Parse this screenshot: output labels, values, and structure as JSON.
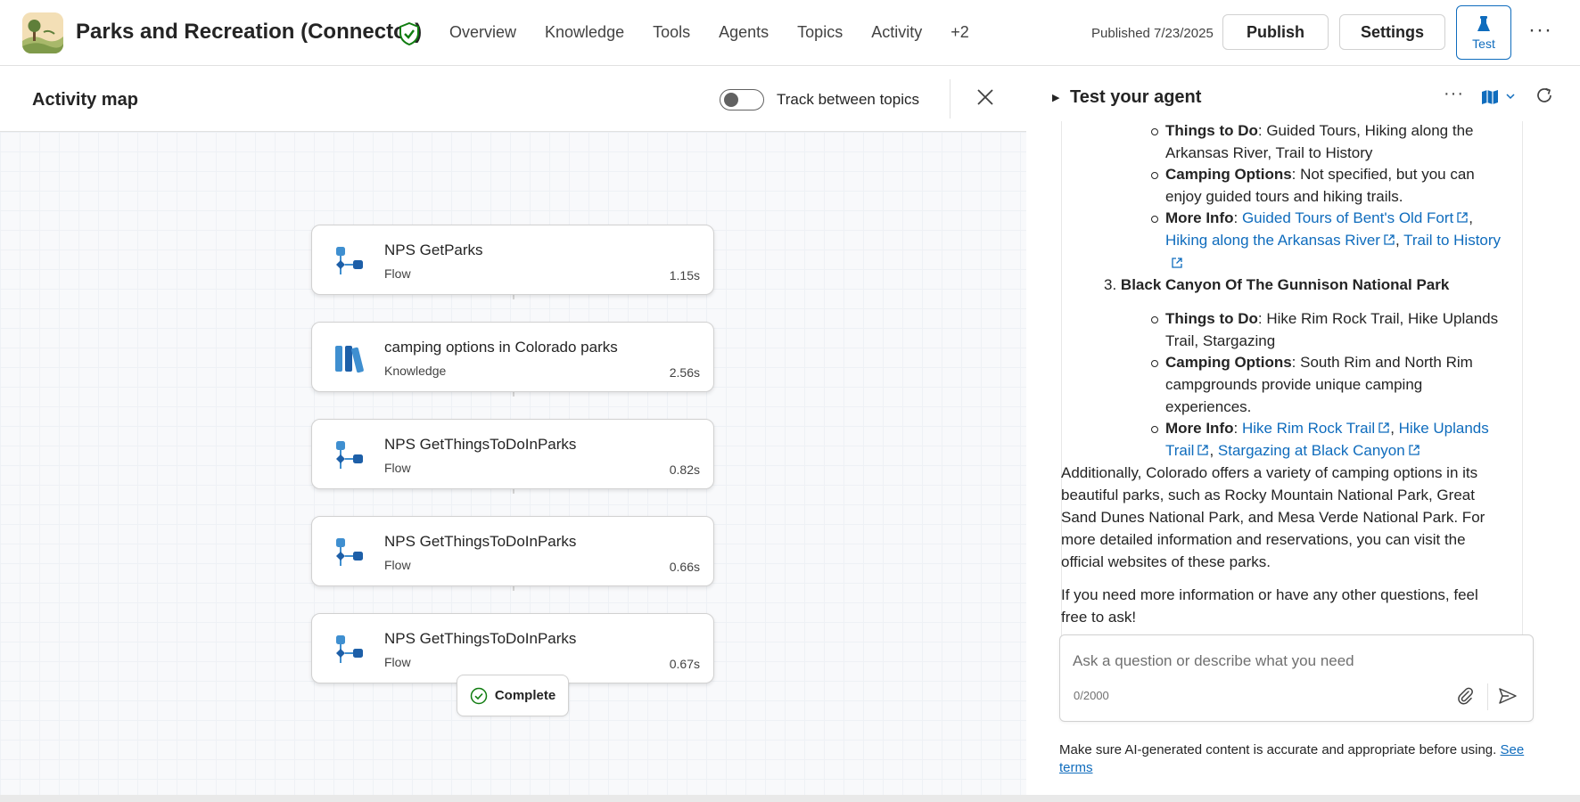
{
  "header": {
    "app_title": "Parks and Recreation (Connector)",
    "nav": [
      "Overview",
      "Knowledge",
      "Tools",
      "Agents",
      "Topics",
      "Activity",
      "+2"
    ],
    "published": "Published 7/23/2025",
    "publish_label": "Publish",
    "settings_label": "Settings",
    "test_label": "Test",
    "more_label": "···"
  },
  "activity_map": {
    "title": "Activity map",
    "toggle_label": "Track between topics",
    "toggle_on": false,
    "steps": [
      {
        "title": "NPS GetParks",
        "type": "Flow",
        "time": "1.15s",
        "icon": "flow-icon"
      },
      {
        "title": "camping options in Colorado parks",
        "type": "Knowledge",
        "time": "2.56s",
        "icon": "knowledge-icon"
      },
      {
        "title": "NPS GetThingsToDoInParks",
        "type": "Flow",
        "time": "0.82s",
        "icon": "flow-icon"
      },
      {
        "title": "NPS GetThingsToDoInParks",
        "type": "Flow",
        "time": "0.66s",
        "icon": "flow-icon"
      },
      {
        "title": "NPS GetThingsToDoInParks",
        "type": "Flow",
        "time": "0.67s",
        "icon": "flow-icon"
      }
    ],
    "complete_label": "Complete"
  },
  "test_panel": {
    "title": "Test your agent",
    "more_label": "···",
    "chat": {
      "park2_todo_label": "Things to Do",
      "park2_todo_1": ": Guided Tours, Hiking along the",
      "park2_todo_2": "Arkansas River, Trail to History",
      "park2_camp_label": "Camping Options",
      "park2_camp_1": ": Not specified, but you can",
      "park2_camp_2": "enjoy guided tours and hiking trails.",
      "park2_more_label": "More Info",
      "park2_link_1": "Guided Tours of Bent's Old Fort",
      "park2_link_2": "Hiking along the Arkansas River",
      "park2_link_3": "Trail to History",
      "park3_number": "3.",
      "park3_name": "Black Canyon Of The Gunnison National Park",
      "park3_todo_label": "Things to Do",
      "park3_todo_1": ": Hike Rim Rock Trail, Hike Uplands",
      "park3_todo_2": "Trail, Stargazing",
      "park3_camp_label": "Camping Options",
      "park3_camp_1": ": South Rim and North Rim",
      "park3_camp_2": "campgrounds provide unique camping",
      "park3_camp_3": "experiences.",
      "park3_more_label": "More Info",
      "park3_link_1": "Hike Rim Rock Trail",
      "park3_link_2a": "Hike Uplands",
      "park3_link_2b": "Trail",
      "park3_link_3": "Stargazing at Black Canyon",
      "para1": [
        "Additionally, Colorado offers a variety of camping options in its",
        "beautiful parks, such as Rocky Mountain National Park, Great",
        "Sand Dunes National Park, and Mesa Verde National Park. For",
        "more detailed information and reservations, you can visit the",
        "official websites of these parks."
      ],
      "para2": [
        "If you need more information or have any other questions, feel",
        "free to ask!"
      ]
    },
    "input_placeholder": "Ask a question or describe what you need",
    "char_count": "0/2000",
    "disclaimer": "Make sure AI-generated content is accurate and appropriate before using.",
    "see_terms": "See terms"
  },
  "colors": {
    "accent": "#0f6cbd",
    "link": "#0f6cbd",
    "flow_icon": "#3f8fd0",
    "success": "#107c10"
  }
}
